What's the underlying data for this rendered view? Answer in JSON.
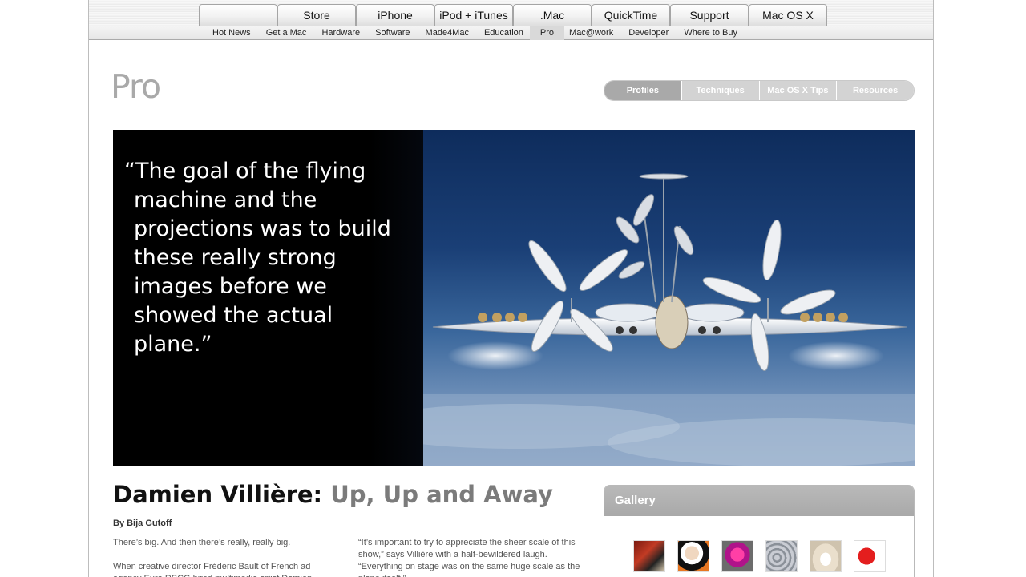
{
  "globalnav": {
    "tabs": [
      {
        "label": "",
        "icon": "apple-logo-icon"
      },
      {
        "label": "Store"
      },
      {
        "label": "iPhone"
      },
      {
        "label": "iPod + iTunes"
      },
      {
        "label": ".Mac"
      },
      {
        "label": "QuickTime"
      },
      {
        "label": "Support"
      },
      {
        "label": "Mac OS X"
      }
    ],
    "apple_glyph": "",
    "subnav": [
      "Hot News",
      "Get a Mac",
      "Hardware",
      "Software",
      "Made4Mac",
      "Education",
      "Pro",
      "Mac@work",
      "Developer",
      "Where to Buy"
    ],
    "subnav_active": "Pro"
  },
  "section": {
    "title": "Pro",
    "tabs": [
      "Profiles",
      "Techniques",
      "Mac OS X Tips",
      "Resources"
    ],
    "active_tab": "Profiles"
  },
  "hero": {
    "quote": "“The goal of the flying machine and the projections was to build these really strong images before we showed the actual plane.”",
    "colors": {
      "sky_top": "#0e2c5c",
      "sky_bottom": "#8ba4c5",
      "panel": "#000000"
    }
  },
  "article": {
    "title_name": "Damien Villière:",
    "title_sub": " Up, Up and Away",
    "byline": "By Bija Gutoff",
    "col1": [
      "There’s big. And then there’s really, really big.",
      "When creative director Frédéric Bault of French ad agency Euro RSCG hired multimedia artist Damien"
    ],
    "col2": [
      "“It’s important to try to appreciate the sheer scale of this show,” says Villière with a half-bewildered laugh. “Everything on stage was on the same huge scale as the plane itself.”"
    ]
  },
  "gallery": {
    "title": "Gallery",
    "thumbs": [
      "thumb-1",
      "thumb-2",
      "thumb-3",
      "thumb-4",
      "thumb-5",
      "thumb-6"
    ]
  }
}
